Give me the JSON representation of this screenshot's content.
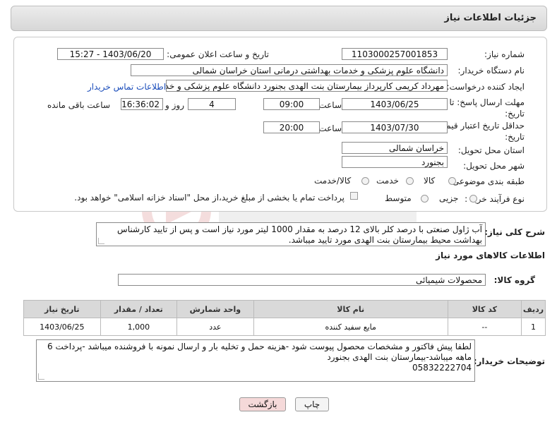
{
  "header": {
    "title": "جزئیات اطلاعات نیاز"
  },
  "fields": {
    "need_number_label": "شماره نیاز:",
    "need_number": "1103000257001853",
    "announce_label": "تاریخ و ساعت اعلان عمومی:",
    "announce_value": "1403/06/20 - 15:27",
    "buyer_org_label": "نام دستگاه خریدار:",
    "buyer_org": "دانشگاه علوم پزشکی و خدمات بهداشتی درمانی استان خراسان شمالی",
    "creator_label": "ایجاد کننده درخواست:",
    "creator": "مهرداد کریمی کارپرداز بیمارستان بنت الهدی بجنورد دانشگاه علوم پزشکی و خد",
    "buyer_contact_link": "اطلاعات تماس خریدار",
    "reply_deadline_label": "مهلت ارسال پاسخ: تا تاریخ:",
    "reply_date": "1403/06/25",
    "time_label": "ساعت",
    "reply_time": "09:00",
    "days": "4",
    "days_label": "روز و",
    "remaining_time": "16:36:02",
    "remaining_label": "ساعت باقی مانده",
    "price_validity_label": "حداقل تاریخ اعتبار قیمت: تا تاریخ:",
    "price_date": "1403/07/30",
    "price_time_label": "ساعت",
    "price_time": "20:00",
    "province_label": "استان محل تحویل:",
    "province": "خراسان شمالی",
    "city_label": "شهر محل تحویل:",
    "city": "بجنورد",
    "category_label": "طبقه بندی موضوعی:",
    "category_options": [
      "کالا",
      "خدمت",
      "کالا/خدمت"
    ],
    "purchase_type_label": "نوع فرآیند خرید :",
    "purchase_options": [
      "جزیی",
      "متوسط"
    ],
    "payment_note": "پرداخت تمام یا بخشی از مبلغ خرید،از محل \"اسناد خزانه اسلامی\" خواهد بود."
  },
  "description": {
    "label": "شرح کلی نیاز:",
    "text": "آب ژاول صنعتی با درصد کلر بالای 12 درصد به مقدار 1000 لیتر مورد نیاز است و پس از  تایید کارشناس بهداشت محیط بیمارستان بنت الهدی مورد تایید میباشد."
  },
  "goods": {
    "section_title": "اطلاعات کالاهای مورد نیاز",
    "group_label": "گروه کالا:",
    "group_value": "محصولات شیمیائی",
    "columns": [
      "ردیف",
      "کد کالا",
      "نام کالا",
      "واحد شمارش",
      "تعداد / مقدار",
      "تاریخ نیاز"
    ],
    "rows": [
      [
        "1",
        "--",
        "مایع سفید کننده",
        "عدد",
        "1,000",
        "1403/06/25"
      ]
    ]
  },
  "notes": {
    "label": "توضیحات خریدار:",
    "lines": [
      "لطفا پیش فاکتور و مشخصات محصول پیوست شود -هزینه حمل و تخلیه بار و ارسال نمونه با فروشنده میباشد -پرداخت 6",
      "ماهه میباشد-بیمارستان بنت الهدی بجنورد",
      "05832222704"
    ]
  },
  "buttons": {
    "print": "چاپ",
    "back": "بازگشت"
  },
  "colors": {
    "link": "#1b4dbb",
    "back_button_bg": "#f5d9d9",
    "header_bg": "#dedede"
  }
}
